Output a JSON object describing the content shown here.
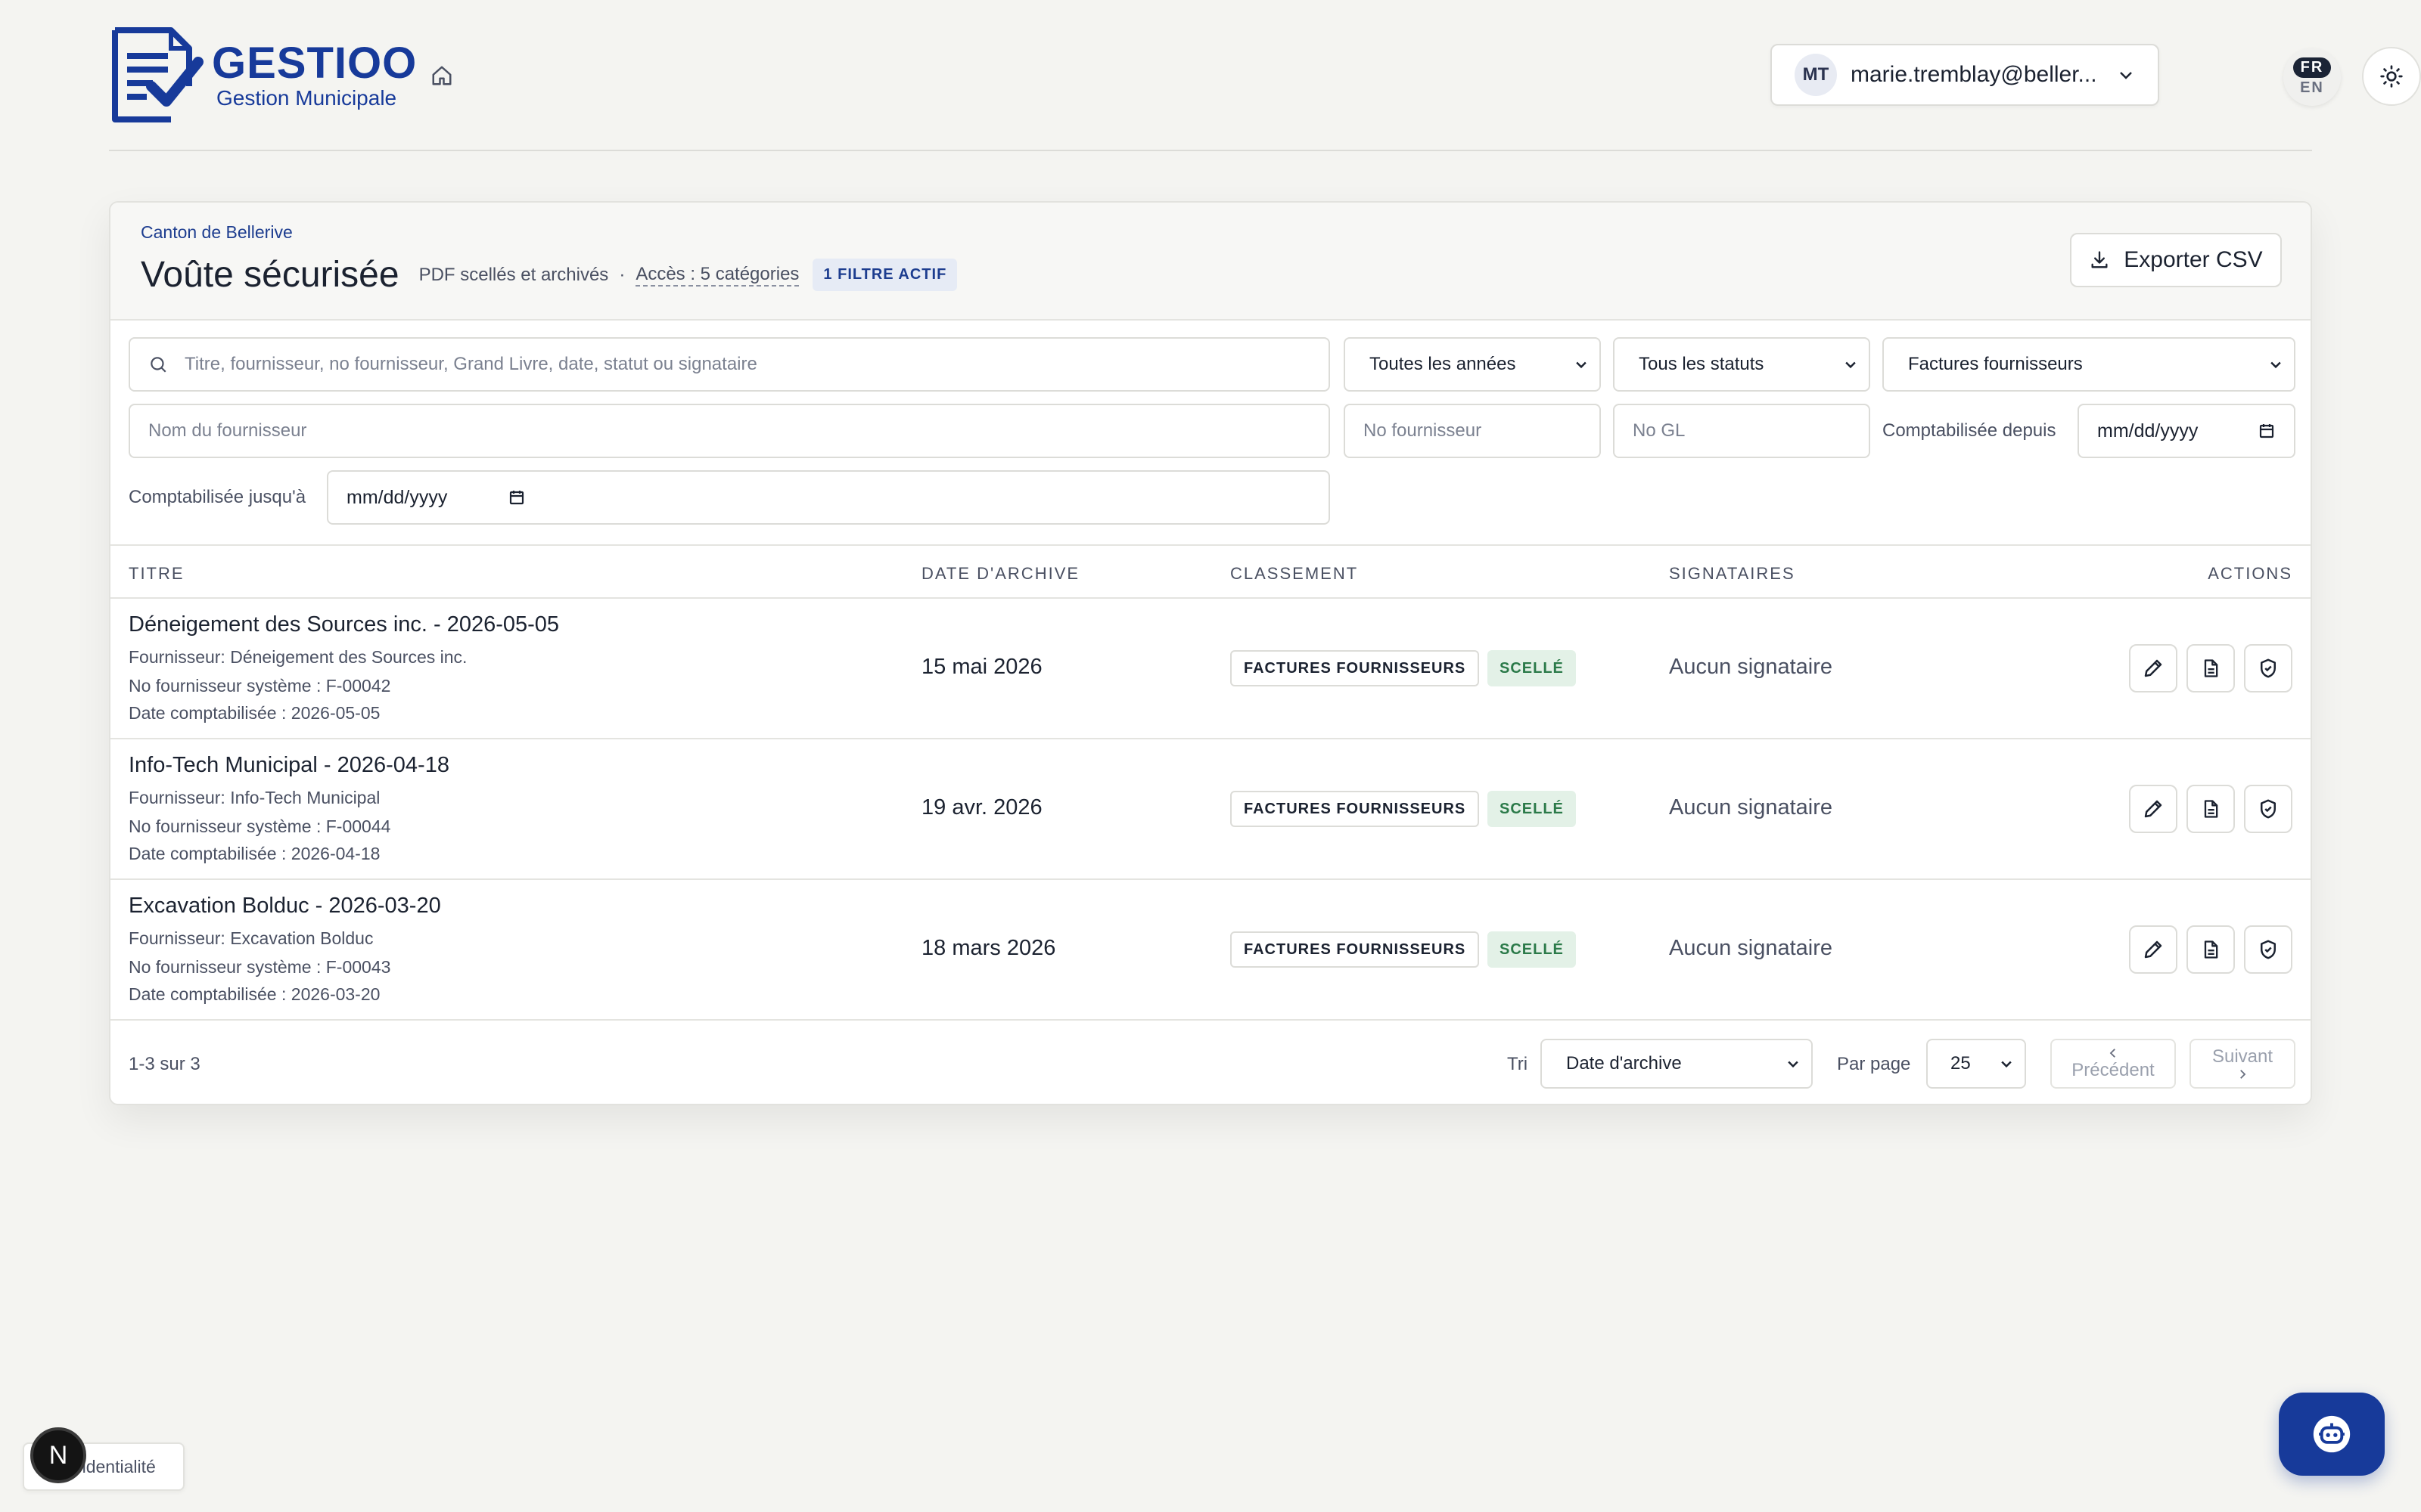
{
  "header": {
    "brand_name": "GESTIOO",
    "brand_subtitle": "Gestion Municipale",
    "user_initials": "MT",
    "user_email": "marie.tremblay@beller...",
    "lang_active": "FR",
    "lang_other": "EN"
  },
  "vault": {
    "org": "Canton de Bellerive",
    "title": "Voûte sécurisée",
    "subtitle": "PDF scellés et archivés",
    "separator": "·",
    "access": "Accès : 5 catégories",
    "filter_badge": "1 FILTRE ACTIF",
    "export_label": "Exporter CSV"
  },
  "filters": {
    "search_placeholder": "Titre, fournisseur, no fournisseur, Grand Livre, date, statut ou signataire",
    "year_select": "Toutes les années",
    "status_select": "Tous les statuts",
    "category_select": "Factures fournisseurs",
    "supplier_name_placeholder": "Nom du fournisseur",
    "supplier_no_placeholder": "No fournisseur",
    "gl_placeholder": "No GL",
    "posted_from_label": "Comptabilisée depuis",
    "posted_from_value": "mm/dd/yyyy",
    "posted_to_label": "Comptabilisée jusqu'à",
    "posted_to_value": "mm/dd/yyyy"
  },
  "table": {
    "columns": [
      "TITRE",
      "DATE D'ARCHIVE",
      "CLASSEMENT",
      "SIGNATAIRES",
      "ACTIONS"
    ],
    "rows": [
      {
        "title": "Déneigement des Sources inc. - 2026-05-05",
        "supplier": "Fournisseur: Déneigement des Sources inc.",
        "supplier_no": "No fournisseur système : F-00042",
        "posted": "Date comptabilisée : 2026-05-05",
        "archive_date": "15 mai 2026",
        "category": "FACTURES FOURNISSEURS",
        "status": "SCELLÉ",
        "signers": "Aucun signataire"
      },
      {
        "title": "Info-Tech Municipal - 2026-04-18",
        "supplier": "Fournisseur: Info-Tech Municipal",
        "supplier_no": "No fournisseur système : F-00044",
        "posted": "Date comptabilisée : 2026-04-18",
        "archive_date": "19 avr. 2026",
        "category": "FACTURES FOURNISSEURS",
        "status": "SCELLÉ",
        "signers": "Aucun signataire"
      },
      {
        "title": "Excavation Bolduc - 2026-03-20",
        "supplier": "Fournisseur: Excavation Bolduc",
        "supplier_no": "No fournisseur système : F-00043",
        "posted": "Date comptabilisée : 2026-03-20",
        "archive_date": "18 mars 2026",
        "category": "FACTURES FOURNISSEURS",
        "status": "SCELLÉ",
        "signers": "Aucun signataire"
      }
    ]
  },
  "footer": {
    "count": "1-3 sur 3",
    "sort_label": "Tri",
    "sort_value": "Date d'archive",
    "per_page_label": "Par page",
    "per_page_value": "25",
    "prev_label": "Précédent",
    "next_label": "Suivant"
  },
  "floating": {
    "privacy_label": "Confidentialité",
    "next_badge": "N"
  },
  "colors": {
    "brand": "#173a9a",
    "sealed_bg": "#e3f1e7",
    "sealed_text": "#2b7a49",
    "page_bg": "#f4f4f1"
  }
}
